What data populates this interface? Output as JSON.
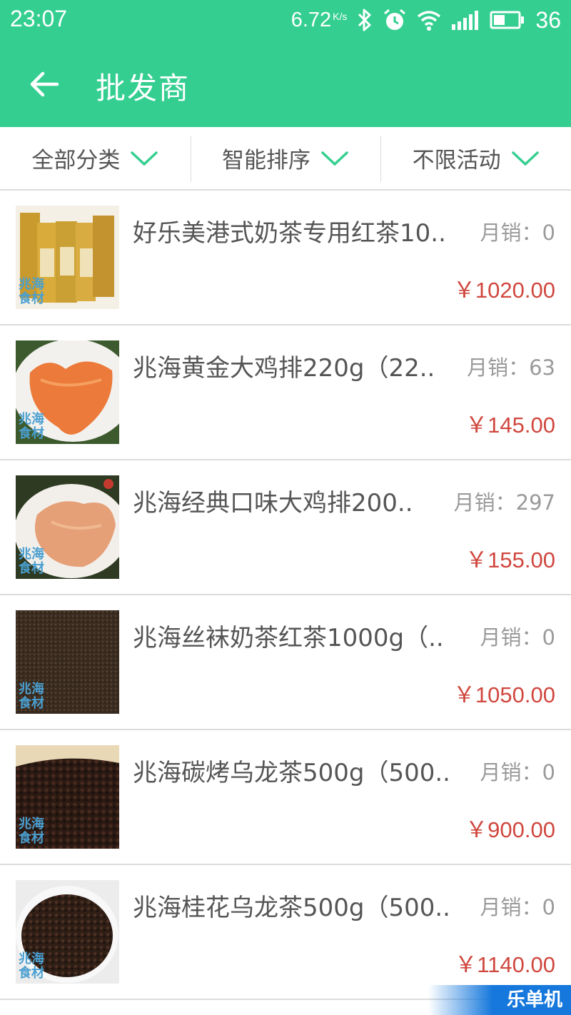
{
  "status_bar": {
    "time": "23:07",
    "net_speed": "6.72",
    "net_unit": "K/s",
    "battery": "36",
    "icons": [
      "bluetooth-icon",
      "alarm-icon",
      "wifi-icon",
      "signal-icon",
      "battery-icon"
    ]
  },
  "app_bar": {
    "title": "批发商",
    "color": "#34cf90"
  },
  "filters": [
    {
      "label": "全部分类"
    },
    {
      "label": "智能排序"
    },
    {
      "label": "不限活动"
    }
  ],
  "products": [
    {
      "name": "好乐美港式奶茶专用红茶10..",
      "sales": "月销：0",
      "price": "￥1020.00",
      "image": "gold-tea-bags"
    },
    {
      "name": "兆海黄金大鸡排220g（22..",
      "sales": "月销：63",
      "price": "￥145.00",
      "image": "golden-chicken-cutlet"
    },
    {
      "name": "兆海经典口味大鸡排200..",
      "sales": "月销：297",
      "price": "￥155.00",
      "image": "classic-chicken-cutlet"
    },
    {
      "name": "兆海丝袜奶茶红茶1000g（..",
      "sales": "月销：0",
      "price": "￥1050.00",
      "image": "black-tea-leaves"
    },
    {
      "name": "兆海碳烤乌龙茶500g（500..",
      "sales": "月销：0",
      "price": "￥900.00",
      "image": "roasted-oolong"
    },
    {
      "name": "兆海桂花乌龙茶500g（500..",
      "sales": "月销：0",
      "price": "￥1140.00",
      "image": "osmanthus-oolong"
    }
  ],
  "watermark": {
    "line1": "兆海",
    "line2": "食材"
  },
  "brand_logo": "乐单机",
  "colors": {
    "accent": "#34cf90",
    "price": "#d0473e",
    "sales": "#9a9a9a"
  }
}
